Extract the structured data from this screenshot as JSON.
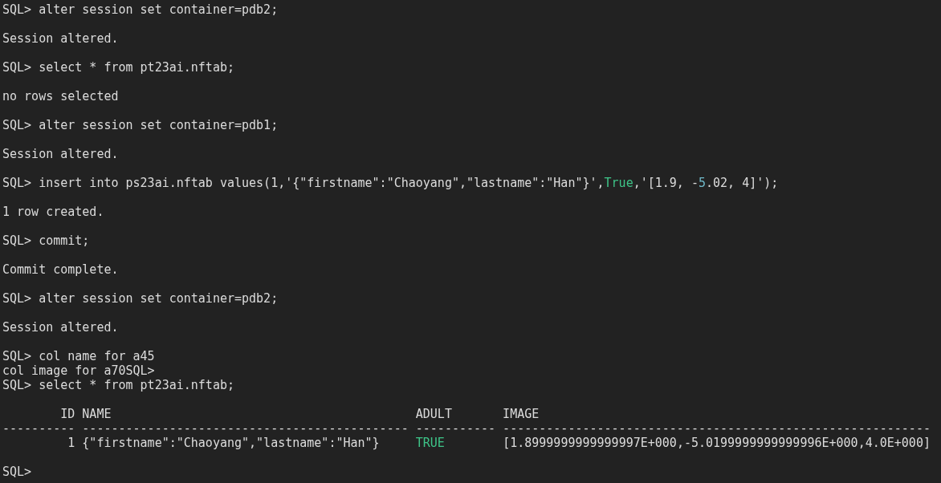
{
  "terminal": {
    "blocks": [
      [
        [
          {
            "text": "SQL> alter session set container=pdb2;",
            "kind": "plain"
          }
        ]
      ],
      [
        [
          {
            "text": "Session altered.",
            "kind": "plain"
          }
        ]
      ],
      [
        [
          {
            "text": "SQL> select * from pt23ai.nftab;",
            "kind": "plain"
          }
        ]
      ],
      [
        [
          {
            "text": "no rows selected",
            "kind": "plain"
          }
        ]
      ],
      [
        [
          {
            "text": "SQL> alter session set container=pdb1;",
            "kind": "plain"
          }
        ]
      ],
      [
        [
          {
            "text": "Session altered.",
            "kind": "plain"
          }
        ]
      ],
      [
        [
          {
            "text": "SQL> insert into ps23ai.nftab values(1,'{\"firstname\":\"Chaoyang\",\"lastname\":\"Han\"}',",
            "kind": "plain"
          },
          {
            "text": "True",
            "kind": "keyword"
          },
          {
            "text": ",'[1.9, -",
            "kind": "plain"
          },
          {
            "text": "5",
            "kind": "number"
          },
          {
            "text": ".02, 4]');",
            "kind": "plain"
          }
        ]
      ],
      [
        [
          {
            "text": "1 row created.",
            "kind": "plain"
          }
        ]
      ],
      [
        [
          {
            "text": "SQL> commit;",
            "kind": "plain"
          }
        ]
      ],
      [
        [
          {
            "text": "Commit complete.",
            "kind": "plain"
          }
        ]
      ],
      [
        [
          {
            "text": "SQL> alter session set container=pdb2;",
            "kind": "plain"
          }
        ]
      ],
      [
        [
          {
            "text": "Session altered.",
            "kind": "plain"
          }
        ]
      ],
      [
        [
          {
            "text": "SQL> col name for a45",
            "kind": "plain"
          }
        ],
        [
          {
            "text": "col image for a70SQL>",
            "kind": "plain"
          }
        ],
        [
          {
            "text": "SQL> select * from pt23ai.nftab;",
            "kind": "plain"
          }
        ]
      ],
      [
        [
          {
            "text": "        ID NAME                                          ADULT       IMAGE",
            "kind": "plain"
          }
        ],
        [
          {
            "text": "---------- --------------------------------------------- ----------- -----------------------------------------------------------",
            "kind": "plain"
          }
        ],
        [
          {
            "text": "         1 {\"firstname\":\"Chaoyang\",\"lastname\":\"Han\"}     ",
            "kind": "plain"
          },
          {
            "text": "TRUE",
            "kind": "keyword"
          },
          {
            "text": "        [1.8999999999999997E+000,-5.0199999999999996E+000,4.0E+000]",
            "kind": "plain"
          }
        ]
      ],
      [
        [
          {
            "text": "SQL>",
            "kind": "plain"
          }
        ]
      ]
    ]
  }
}
